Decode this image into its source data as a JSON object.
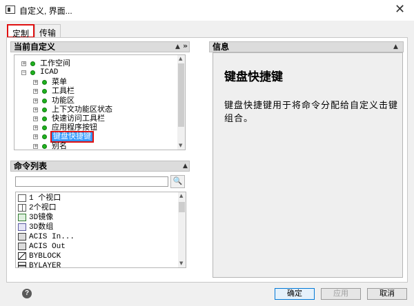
{
  "window": {
    "title": "自定义, 界面...",
    "close_glyph": "✕"
  },
  "tabs": [
    {
      "label": "定制"
    },
    {
      "label": "传输"
    }
  ],
  "customize_panel": {
    "header": "当前自定义",
    "collapse_glyph": "▲",
    "expand_glyph": "»",
    "tree": [
      {
        "label": "工作空间",
        "expander": "+"
      },
      {
        "label": "ICAD",
        "expander": "−"
      },
      {
        "label": "菜单",
        "expander": "+"
      },
      {
        "label": "工具栏",
        "expander": "+"
      },
      {
        "label": "功能区",
        "expander": "+"
      },
      {
        "label": "上下文功能区状态",
        "expander": "+"
      },
      {
        "label": "快速访问工具栏",
        "expander": "+"
      },
      {
        "label": "应用程序按钮",
        "expander": "+"
      },
      {
        "label": "键盘快捷键",
        "expander": "+",
        "selected": true
      },
      {
        "label": "别名",
        "expander": "+"
      }
    ]
  },
  "command_panel": {
    "header": "命令列表",
    "collapse_glyph": "▲",
    "search_placeholder": "",
    "search_glyph": "🔍",
    "items": [
      {
        "label": "1 个视口",
        "icon": "viewport-icon"
      },
      {
        "label": "2个视口",
        "icon": "two-viewports-icon"
      },
      {
        "label": "3D镜像",
        "icon": "mirror3d-icon"
      },
      {
        "label": "3D数组",
        "icon": "array3d-icon"
      },
      {
        "label": "ACIS In...",
        "icon": "acis-in-icon"
      },
      {
        "label": "ACIS Out",
        "icon": "acis-out-icon"
      },
      {
        "label": "BYBLOCK",
        "icon": "byblock-icon"
      },
      {
        "label": "BYLAYER",
        "icon": "bylayer-icon"
      }
    ]
  },
  "info_panel": {
    "header": "信息",
    "collapse_glyph": "▲",
    "title": "键盘快捷键",
    "description": "键盘快捷键用于将命令分配给自定义击键组合。"
  },
  "footer": {
    "help_glyph": "?",
    "ok_label": "确定",
    "apply_label": "应用",
    "cancel_label": "取消"
  },
  "colors": {
    "selection": "#3399ff",
    "highlight_border": "#e01010",
    "tree_dot": "#1fb21f"
  }
}
